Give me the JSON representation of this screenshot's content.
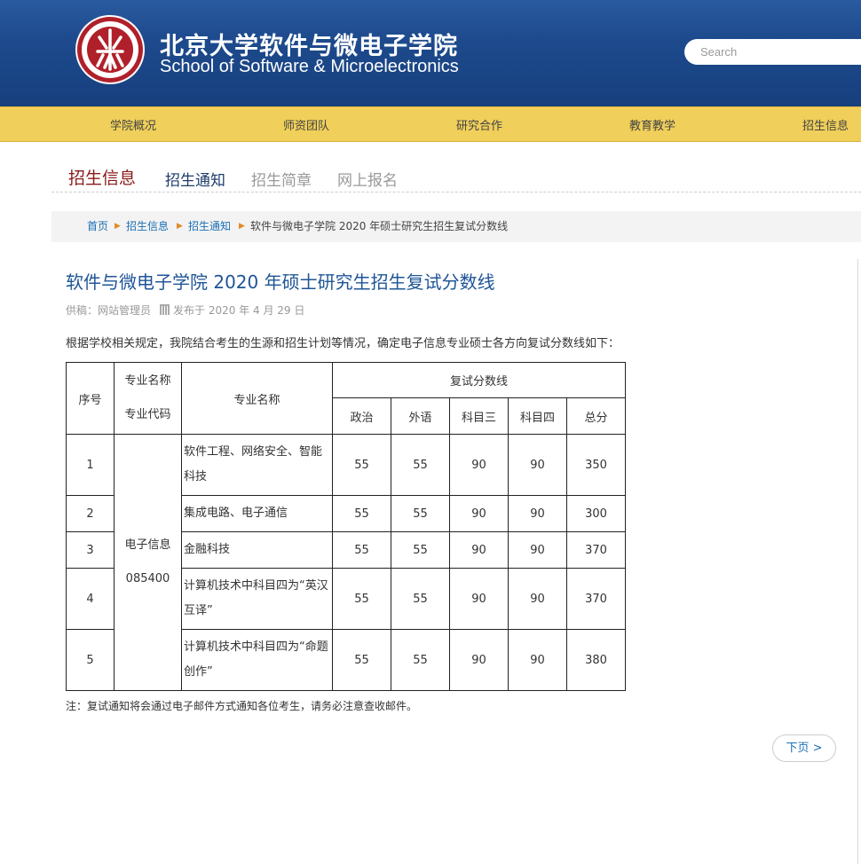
{
  "header": {
    "title_cn": "北京大学软件与微电子学院",
    "title_en": "School of Software & Microelectronics",
    "search_placeholder": "Search",
    "logo_text": "PEKING UNIVERSITY 1898",
    "logo_year": "1898"
  },
  "nav": {
    "items": [
      {
        "label": "学院概况"
      },
      {
        "label": "师资团队"
      },
      {
        "label": "研究合作"
      },
      {
        "label": "教育教学"
      },
      {
        "label": "招生信息"
      }
    ]
  },
  "subnav": {
    "title": "招生信息",
    "items": [
      {
        "label": "招生通知",
        "active": true
      },
      {
        "label": "招生简章",
        "active": false
      },
      {
        "label": "网上报名",
        "active": false
      }
    ]
  },
  "breadcrumb": {
    "items": [
      "首页",
      "招生信息",
      "招生通知"
    ],
    "current": "软件与微电子学院 2020 年硕士研究生招生复试分数线",
    "separator_icon": "triangle-right-icon"
  },
  "article": {
    "title": "软件与微电子学院 2020 年硕士研究生招生复试分数线",
    "author": "供稿：网站管理员",
    "date": "发布于 2020 年 4 月 29 日",
    "date_icon": "calendar-icon",
    "intro": "根据学校相关规定，我院结合考生的生源和招生计划等情况，确定电子信息专业硕士各方向复试分数线如下：",
    "note": "注：复试通知将会通过电子邮件方式通知各位考生，请务必注意查收邮件。"
  },
  "table": {
    "headers": {
      "seq": "序号",
      "major_name_label": "专业名称",
      "major_code_label": "专业代码",
      "direction": "专业名称",
      "score_group": "复试分数线",
      "cols": [
        "政治",
        "外语",
        "科目三",
        "科目四",
        "总分"
      ]
    },
    "major": {
      "name": "电子信息",
      "code": "085400"
    },
    "rows": [
      {
        "seq": "1",
        "name": "软件工程、网络安全、智能科技",
        "scores": [
          "55",
          "55",
          "90",
          "90",
          "350"
        ]
      },
      {
        "seq": "2",
        "name": "集成电路、电子通信",
        "scores": [
          "55",
          "55",
          "90",
          "90",
          "300"
        ]
      },
      {
        "seq": "3",
        "name": "金融科技",
        "scores": [
          "55",
          "55",
          "90",
          "90",
          "370"
        ]
      },
      {
        "seq": "4",
        "name": "计算机技术中科目四为“英汉互译”",
        "scores": [
          "55",
          "55",
          "90",
          "90",
          "370"
        ]
      },
      {
        "seq": "5",
        "name": "计算机技术中科目四为“命题创作”",
        "scores": [
          "55",
          "55",
          "90",
          "90",
          "380"
        ]
      }
    ]
  },
  "pager": {
    "next": "下页 >"
  },
  "colors": {
    "header_blue": "#1e4b8e",
    "nav_yellow": "#f0cf5a",
    "link_blue": "#1a6fb5",
    "title_red": "#8b1a1a",
    "logo_red": "#b0202a"
  }
}
